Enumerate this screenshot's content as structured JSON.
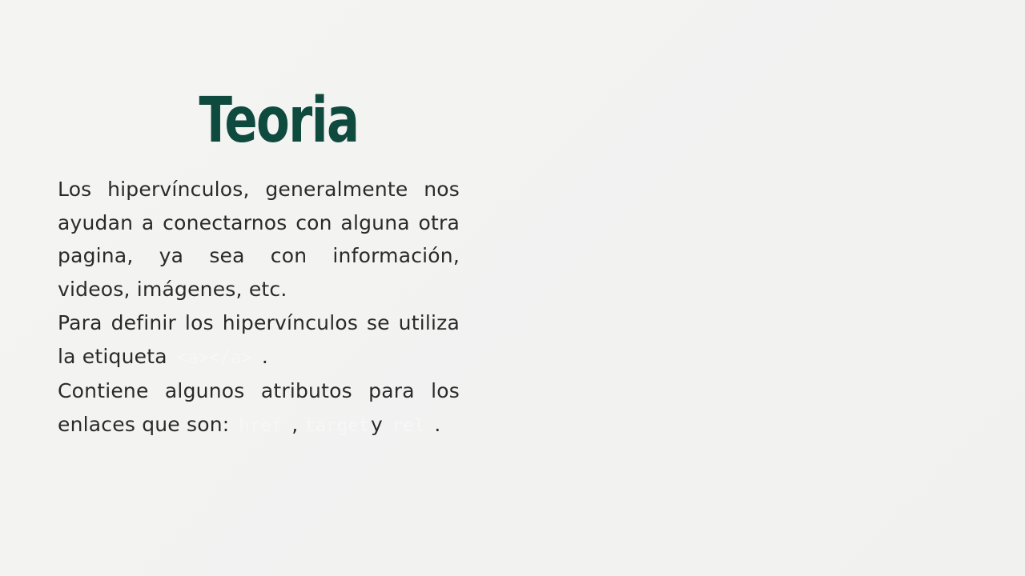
{
  "slide": {
    "title": "Teoria",
    "paragraph_1": "Los hipervínculos, generalmente nos ayudan a conectarnos con alguna otra pagina, ya sea con información, videos, imágenes, etc.",
    "paragraph_2_before": "Para definir los hipervínculos se utiliza la etiqueta",
    "paragraph_2_code": "<a></a>",
    "paragraph_2_after": ".",
    "paragraph_3_before": "Contiene algunos atributos para los enlaces que son:",
    "paragraph_3_code_1": "href",
    "paragraph_3_sep_1": ",",
    "paragraph_3_code_2": "target",
    "paragraph_3_sep_2": "y",
    "paragraph_3_code_3": "rel",
    "paragraph_3_after": "."
  },
  "colors": {
    "background": "#f3f3f2",
    "title": "#0f4a3f",
    "body_text": "#2a2a2a",
    "code_text": "#f7f7f7"
  }
}
